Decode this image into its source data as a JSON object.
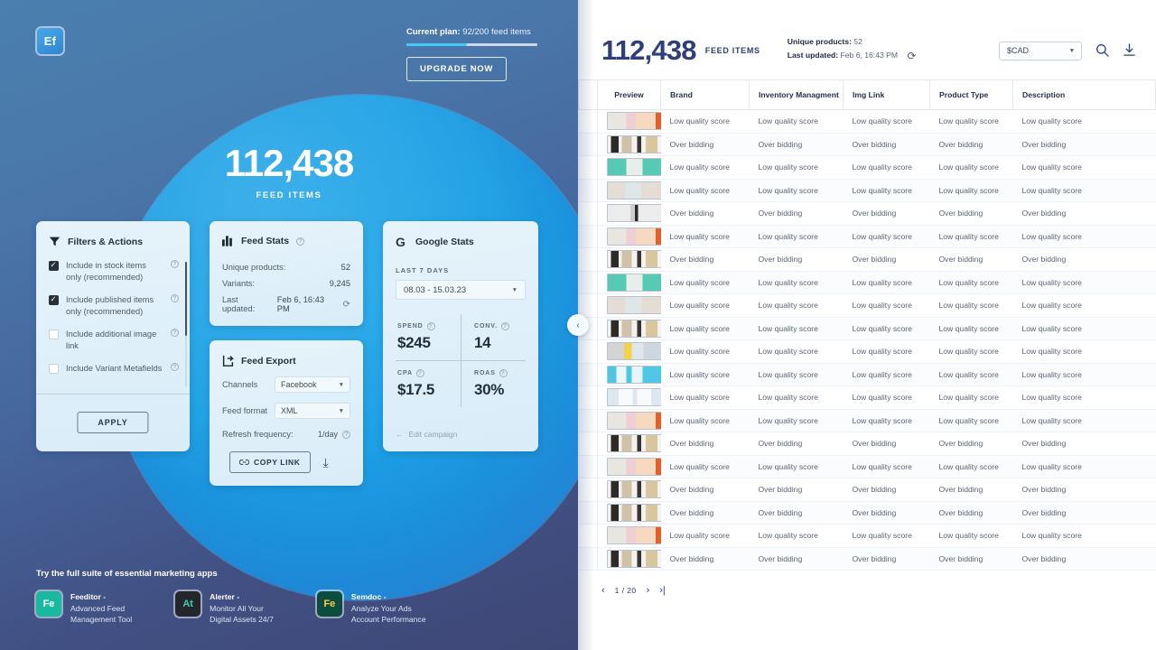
{
  "left": {
    "logo_text": "Ef",
    "plan": {
      "label": "Current plan:",
      "value": "92/200 feed items",
      "percent": 46,
      "upgrade_label": "UPGRADE NOW"
    },
    "hero": {
      "number": "112,438",
      "label": "FEED ITEMS"
    },
    "filters_card": {
      "title": "Filters & Actions",
      "items": [
        {
          "label": "Include in stock items only (recommended)",
          "checked": true
        },
        {
          "label": "Include published items only (recommended)",
          "checked": true
        },
        {
          "label": "Include additional image link",
          "checked": false
        },
        {
          "label": "Include Variant Metafields",
          "checked": false
        }
      ],
      "apply_label": "APPLY"
    },
    "stats_card": {
      "title": "Feed Stats",
      "unique_products_label": "Unique products:",
      "unique_products_value": "52",
      "variants_label": "Variants:",
      "variants_value": "9,245",
      "last_updated_label": "Last updated:",
      "last_updated_value": "Feb 6, 16:43 PM"
    },
    "export_card": {
      "title": "Feed Export",
      "channels_label": "Channels",
      "channels_value": "Facebook",
      "format_label": "Feed format",
      "format_value": "XML",
      "refresh_label": "Refresh frequency:",
      "refresh_value": "1/day",
      "copy_label": "COPY LINK"
    },
    "google_card": {
      "title": "Google Stats",
      "range_label": "LAST 7 DAYS",
      "range_value": "08.03 - 15.03.23",
      "kpis": [
        {
          "key": "SPEND",
          "value": "$245"
        },
        {
          "key": "CONV.",
          "value": "14"
        },
        {
          "key": "CPA",
          "value": "$17.5"
        },
        {
          "key": "ROAS",
          "value": "30%"
        }
      ],
      "edit_campaign": "Edit campaign"
    },
    "apps": {
      "heading": "Try the full suite of essential marketing apps",
      "items": [
        {
          "badge": "Fe",
          "name": "Feeditor -",
          "desc_line1": "Advanced Feed",
          "desc_line2": "Management Tool"
        },
        {
          "badge": "At",
          "name": "Alerter -",
          "desc_line1": "Monitor All Your",
          "desc_line2": "Digital Assets 24/7"
        },
        {
          "badge": "Fe",
          "name": "Semdoc -",
          "desc_line1": "Analyze Your Ads",
          "desc_line2": "Account Performance"
        }
      ]
    }
  },
  "right": {
    "header": {
      "count": "112,438",
      "count_label": "FEED ITEMS",
      "unique_label": "Unique products:",
      "unique_value": "52",
      "updated_label": "Last updated:",
      "updated_value": "Feb 6, 16:43 PM",
      "currency": "$CAD"
    },
    "table": {
      "columns": [
        "",
        "Preview",
        "Brand",
        "Inventory Managment",
        "Img Link",
        "Product Type",
        "Description"
      ],
      "rows": [
        {
          "status": "Low quality score",
          "thumb": "bath-pink"
        },
        {
          "status": "Over bidding",
          "thumb": "makeup-shelf"
        },
        {
          "status": "Low quality score",
          "thumb": "teal-serum"
        },
        {
          "status": "Low quality score",
          "thumb": "beige-bottle"
        },
        {
          "status": "Over bidding",
          "thumb": "grey-dispenser"
        },
        {
          "status": "Low quality score",
          "thumb": "bath-pink"
        },
        {
          "status": "Over bidding",
          "thumb": "makeup-shelf"
        },
        {
          "status": "Low quality score",
          "thumb": "teal-serum"
        },
        {
          "status": "Low quality score",
          "thumb": "beige-bottle"
        },
        {
          "status": "Low quality score",
          "thumb": "makeup-shelf"
        },
        {
          "status": "Low quality score",
          "thumb": "yellow-shelf"
        },
        {
          "status": "Low quality score",
          "thumb": "cyan-shelf"
        },
        {
          "status": "Low quality score",
          "thumb": "dove-pair"
        },
        {
          "status": "Low quality score",
          "thumb": "bath-pink"
        },
        {
          "status": "Over bidding",
          "thumb": "makeup-shelf"
        },
        {
          "status": "Low quality score",
          "thumb": "bath-pink"
        },
        {
          "status": "Over bidding",
          "thumb": "makeup-shelf"
        },
        {
          "status": "Over bidding",
          "thumb": "makeup-shelf"
        },
        {
          "status": "Low quality score",
          "thumb": "bath-pink"
        },
        {
          "status": "Over bidding",
          "thumb": "makeup-shelf"
        }
      ]
    },
    "pagination": {
      "page": "1 / 20"
    }
  }
}
